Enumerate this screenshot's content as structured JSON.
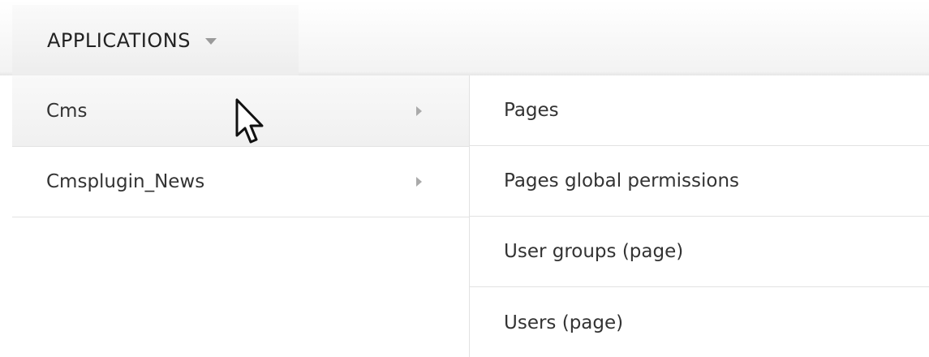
{
  "menubar": {
    "applications_label": "APPLICATIONS"
  },
  "dropdown": {
    "items": [
      {
        "label": "Cms"
      },
      {
        "label": "Cmsplugin_News"
      }
    ]
  },
  "submenu": {
    "items": [
      {
        "label": "Pages"
      },
      {
        "label": "Pages global permissions"
      },
      {
        "label": "User groups (page)"
      },
      {
        "label": "Users (page)"
      }
    ]
  },
  "icons": {
    "caret": "chevron-down-icon",
    "submenu_arrow": "chevron-right-icon",
    "cursor": "mouse-pointer-icon"
  },
  "colors": {
    "text": "#333333",
    "divider": "#e2e2e2",
    "caret": "#9a9a9a",
    "hover_bg": "#f2f2f2"
  }
}
